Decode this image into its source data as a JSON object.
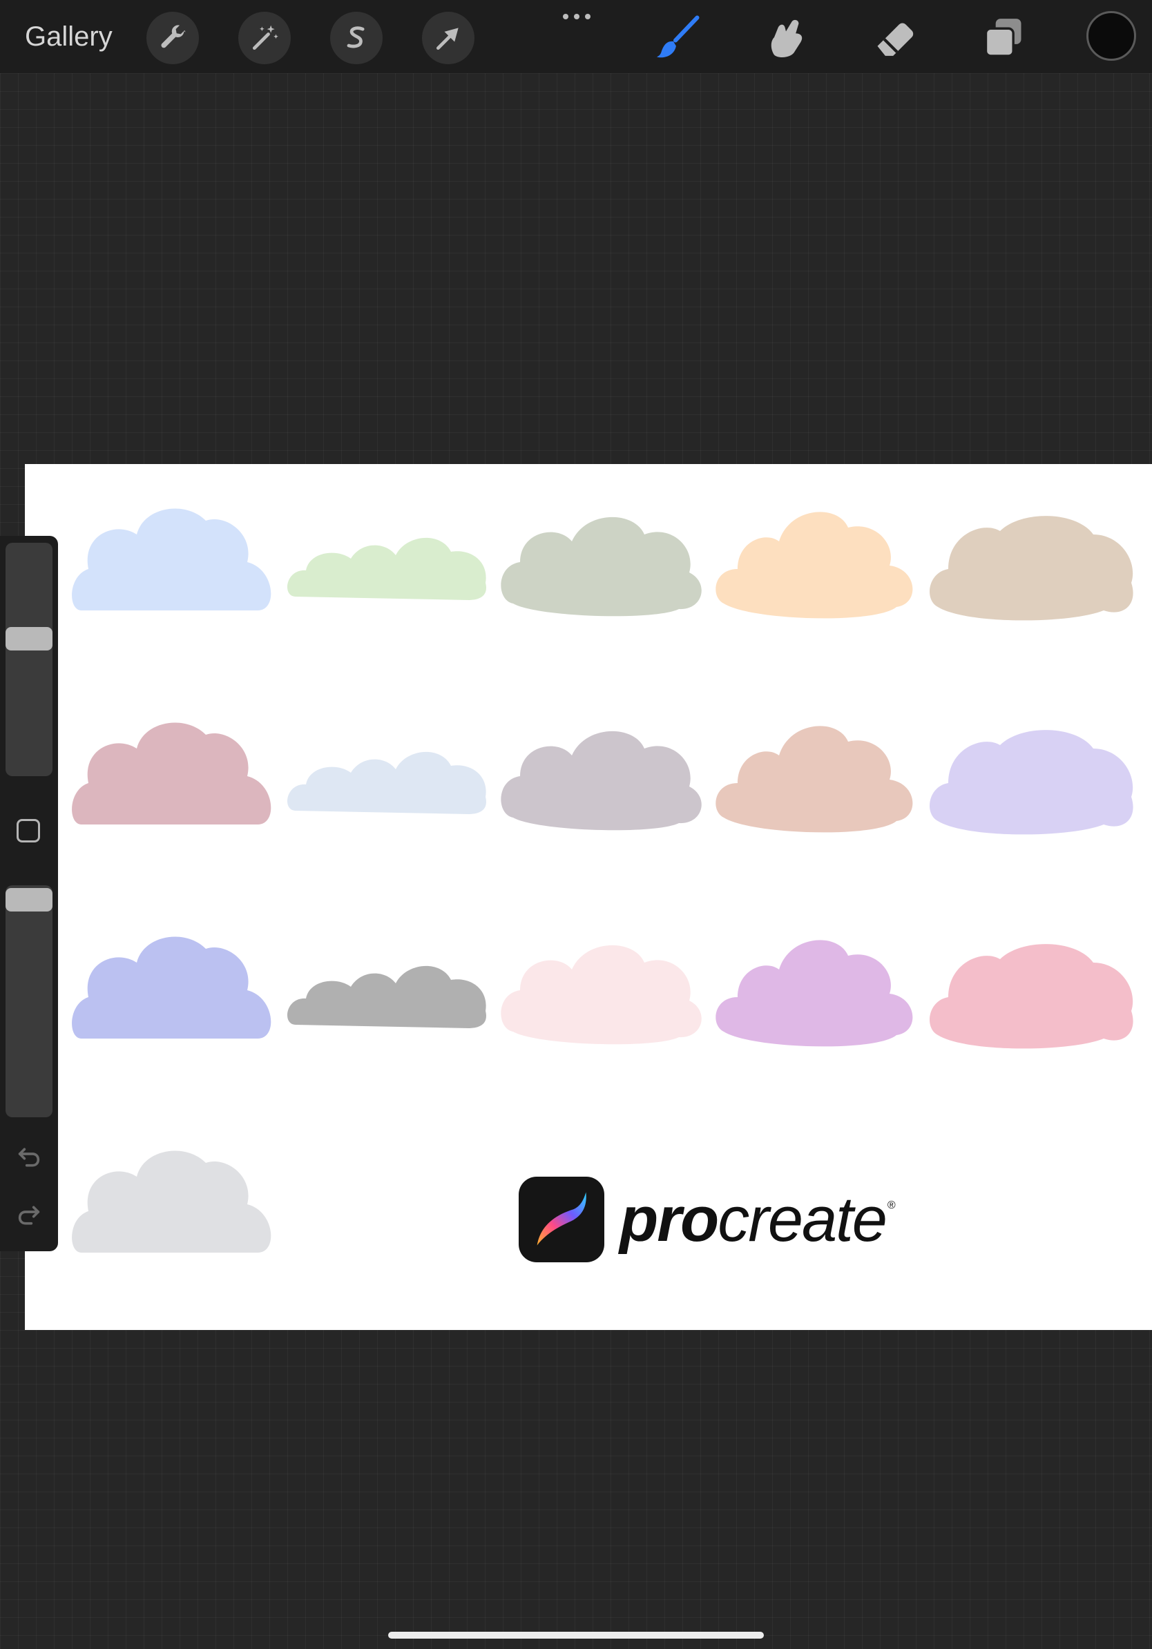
{
  "app": {
    "name": "Procreate"
  },
  "toolbar": {
    "gallery_label": "Gallery",
    "left_tools": [
      {
        "name": "actions",
        "icon": "wrench-icon"
      },
      {
        "name": "adjustments",
        "icon": "magic-wand-icon"
      },
      {
        "name": "selection",
        "icon": "selection-s-icon"
      },
      {
        "name": "transform",
        "icon": "arrow-cursor-icon"
      }
    ],
    "more_icon": "ellipsis-icon",
    "right_tools": [
      {
        "name": "brush",
        "icon": "brush-icon",
        "active": true
      },
      {
        "name": "smudge",
        "icon": "smudge-finger-icon",
        "active": false
      },
      {
        "name": "eraser",
        "icon": "eraser-icon",
        "active": false
      },
      {
        "name": "layers",
        "icon": "layers-icon",
        "active": false
      }
    ],
    "active_color": "#0b0b0b",
    "active_tool_color": "#2f7cf6"
  },
  "sidebar": {
    "brush_size_level": 0.6,
    "opacity_level": 1.0,
    "undo_icon": "undo-arrow-icon",
    "redo_icon": "redo-arrow-icon",
    "modify_icon": "square-modify-icon"
  },
  "canvas": {
    "background": "#ffffff",
    "clouds": [
      {
        "color": "#cfe0fb"
      },
      {
        "color": "#d6ecca"
      },
      {
        "color": "#c9cfc0"
      },
      {
        "color": "#fddcba"
      },
      {
        "color": "#dccbb8"
      },
      {
        "color": "#d9b0b8"
      },
      {
        "color": "#dbe5f2"
      },
      {
        "color": "#c8c0c8"
      },
      {
        "color": "#e6c3b6"
      },
      {
        "color": "#d5cdf3"
      },
      {
        "color": "#b5bcf0"
      },
      {
        "color": "#a9a9a9"
      },
      {
        "color": "#fbe5e7"
      },
      {
        "color": "#dcb2e4"
      },
      {
        "color": "#f3b9c6"
      },
      {
        "color": "#dcdde1"
      }
    ],
    "logo_text_bold": "pro",
    "logo_text_regular": "create",
    "logo_registered": "®"
  }
}
